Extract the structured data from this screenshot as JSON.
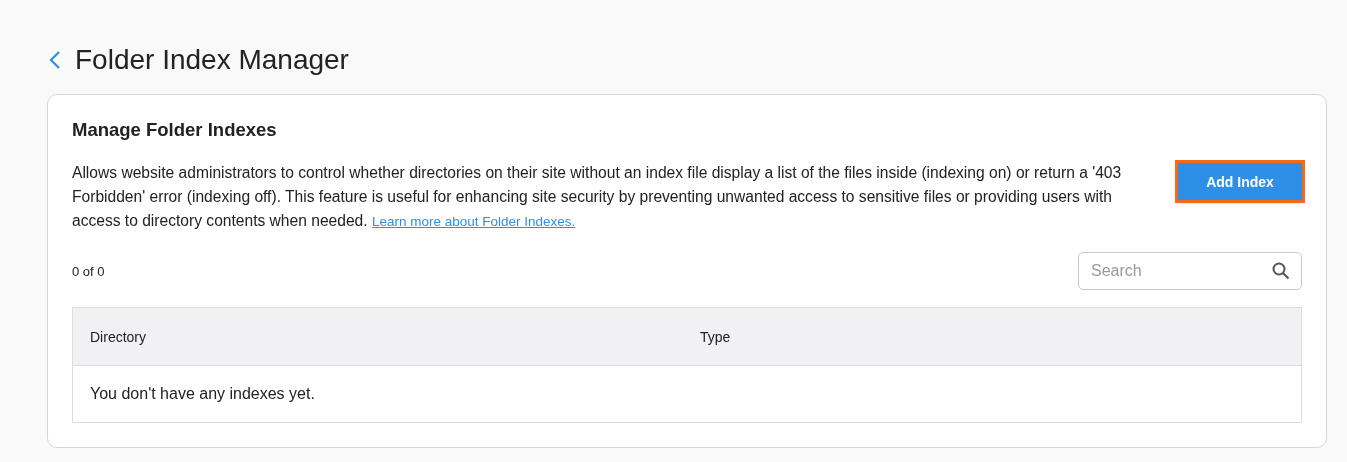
{
  "page": {
    "title": "Folder Index Manager"
  },
  "card": {
    "heading": "Manage Folder Indexes",
    "description": "Allows website administrators to control whether directories on their site without an index file display a list of the files inside (indexing on) or return a '403 Forbidden' error (indexing off). This feature is useful for enhancing site security by preventing unwanted access to sensitive files or providing users with access to directory contents when needed.",
    "learn_more_link": "Learn more about Folder Indexes.",
    "add_button": {
      "label": "Add Index",
      "highlighted": true
    },
    "count": "0 of 0",
    "search": {
      "placeholder": "Search"
    },
    "table": {
      "columns": [
        "Directory",
        "Type"
      ],
      "empty_message": "You don't have any indexes yet."
    }
  }
}
